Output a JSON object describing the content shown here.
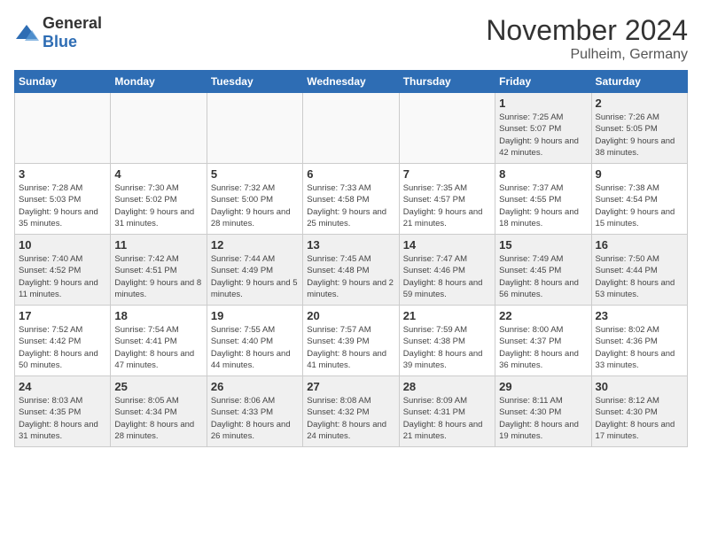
{
  "header": {
    "logo_general": "General",
    "logo_blue": "Blue",
    "title": "November 2024",
    "location": "Pulheim, Germany"
  },
  "days_of_week": [
    "Sunday",
    "Monday",
    "Tuesday",
    "Wednesday",
    "Thursday",
    "Friday",
    "Saturday"
  ],
  "weeks": [
    [
      {
        "day": "",
        "info": ""
      },
      {
        "day": "",
        "info": ""
      },
      {
        "day": "",
        "info": ""
      },
      {
        "day": "",
        "info": ""
      },
      {
        "day": "",
        "info": ""
      },
      {
        "day": "1",
        "info": "Sunrise: 7:25 AM\nSunset: 5:07 PM\nDaylight: 9 hours and 42 minutes."
      },
      {
        "day": "2",
        "info": "Sunrise: 7:26 AM\nSunset: 5:05 PM\nDaylight: 9 hours and 38 minutes."
      }
    ],
    [
      {
        "day": "3",
        "info": "Sunrise: 7:28 AM\nSunset: 5:03 PM\nDaylight: 9 hours and 35 minutes."
      },
      {
        "day": "4",
        "info": "Sunrise: 7:30 AM\nSunset: 5:02 PM\nDaylight: 9 hours and 31 minutes."
      },
      {
        "day": "5",
        "info": "Sunrise: 7:32 AM\nSunset: 5:00 PM\nDaylight: 9 hours and 28 minutes."
      },
      {
        "day": "6",
        "info": "Sunrise: 7:33 AM\nSunset: 4:58 PM\nDaylight: 9 hours and 25 minutes."
      },
      {
        "day": "7",
        "info": "Sunrise: 7:35 AM\nSunset: 4:57 PM\nDaylight: 9 hours and 21 minutes."
      },
      {
        "day": "8",
        "info": "Sunrise: 7:37 AM\nSunset: 4:55 PM\nDaylight: 9 hours and 18 minutes."
      },
      {
        "day": "9",
        "info": "Sunrise: 7:38 AM\nSunset: 4:54 PM\nDaylight: 9 hours and 15 minutes."
      }
    ],
    [
      {
        "day": "10",
        "info": "Sunrise: 7:40 AM\nSunset: 4:52 PM\nDaylight: 9 hours and 11 minutes."
      },
      {
        "day": "11",
        "info": "Sunrise: 7:42 AM\nSunset: 4:51 PM\nDaylight: 9 hours and 8 minutes."
      },
      {
        "day": "12",
        "info": "Sunrise: 7:44 AM\nSunset: 4:49 PM\nDaylight: 9 hours and 5 minutes."
      },
      {
        "day": "13",
        "info": "Sunrise: 7:45 AM\nSunset: 4:48 PM\nDaylight: 9 hours and 2 minutes."
      },
      {
        "day": "14",
        "info": "Sunrise: 7:47 AM\nSunset: 4:46 PM\nDaylight: 8 hours and 59 minutes."
      },
      {
        "day": "15",
        "info": "Sunrise: 7:49 AM\nSunset: 4:45 PM\nDaylight: 8 hours and 56 minutes."
      },
      {
        "day": "16",
        "info": "Sunrise: 7:50 AM\nSunset: 4:44 PM\nDaylight: 8 hours and 53 minutes."
      }
    ],
    [
      {
        "day": "17",
        "info": "Sunrise: 7:52 AM\nSunset: 4:42 PM\nDaylight: 8 hours and 50 minutes."
      },
      {
        "day": "18",
        "info": "Sunrise: 7:54 AM\nSunset: 4:41 PM\nDaylight: 8 hours and 47 minutes."
      },
      {
        "day": "19",
        "info": "Sunrise: 7:55 AM\nSunset: 4:40 PM\nDaylight: 8 hours and 44 minutes."
      },
      {
        "day": "20",
        "info": "Sunrise: 7:57 AM\nSunset: 4:39 PM\nDaylight: 8 hours and 41 minutes."
      },
      {
        "day": "21",
        "info": "Sunrise: 7:59 AM\nSunset: 4:38 PM\nDaylight: 8 hours and 39 minutes."
      },
      {
        "day": "22",
        "info": "Sunrise: 8:00 AM\nSunset: 4:37 PM\nDaylight: 8 hours and 36 minutes."
      },
      {
        "day": "23",
        "info": "Sunrise: 8:02 AM\nSunset: 4:36 PM\nDaylight: 8 hours and 33 minutes."
      }
    ],
    [
      {
        "day": "24",
        "info": "Sunrise: 8:03 AM\nSunset: 4:35 PM\nDaylight: 8 hours and 31 minutes."
      },
      {
        "day": "25",
        "info": "Sunrise: 8:05 AM\nSunset: 4:34 PM\nDaylight: 8 hours and 28 minutes."
      },
      {
        "day": "26",
        "info": "Sunrise: 8:06 AM\nSunset: 4:33 PM\nDaylight: 8 hours and 26 minutes."
      },
      {
        "day": "27",
        "info": "Sunrise: 8:08 AM\nSunset: 4:32 PM\nDaylight: 8 hours and 24 minutes."
      },
      {
        "day": "28",
        "info": "Sunrise: 8:09 AM\nSunset: 4:31 PM\nDaylight: 8 hours and 21 minutes."
      },
      {
        "day": "29",
        "info": "Sunrise: 8:11 AM\nSunset: 4:30 PM\nDaylight: 8 hours and 19 minutes."
      },
      {
        "day": "30",
        "info": "Sunrise: 8:12 AM\nSunset: 4:30 PM\nDaylight: 8 hours and 17 minutes."
      }
    ]
  ]
}
